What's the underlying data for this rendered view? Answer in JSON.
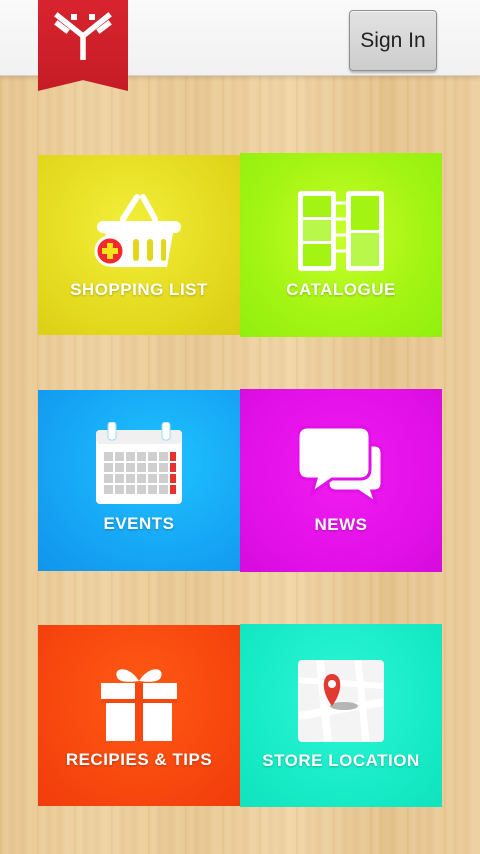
{
  "header": {
    "logo_icon": "brand-logo-icon",
    "brand_color": "#d8242e",
    "signin_label": "Sign In"
  },
  "tiles": [
    {
      "id": "shopping",
      "label": "SHOPPING LIST",
      "icon": "basket-add-icon",
      "color": "#e2d71b"
    },
    {
      "id": "catalogue",
      "label": "CATALOGUE",
      "icon": "catalogue-icon",
      "color": "#a3f412"
    },
    {
      "id": "events",
      "label": "EVENTS",
      "icon": "calendar-icon",
      "color": "#16a5f5"
    },
    {
      "id": "news",
      "label": "NEWS",
      "icon": "chat-bubbles-icon",
      "color": "#e010e6"
    },
    {
      "id": "recipes",
      "label": "RECIPIES & TIPS",
      "icon": "gift-icon",
      "color": "#f7460e"
    },
    {
      "id": "store",
      "label": "STORE LOCATION",
      "icon": "map-pin-icon",
      "color": "#16ebc6"
    }
  ]
}
